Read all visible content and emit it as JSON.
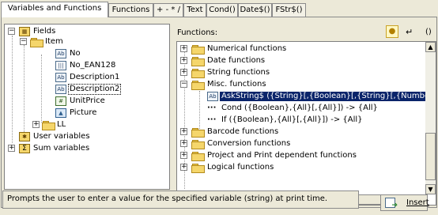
{
  "tabs": [
    {
      "label": "Variables and Functions"
    },
    {
      "label": "Functions"
    },
    {
      "label": "+ - * /"
    },
    {
      "label": "Text"
    },
    {
      "label": "Cond()"
    },
    {
      "label": "Date$()"
    },
    {
      "label": "FStr$()"
    }
  ],
  "left_tree": {
    "fields": "Fields",
    "item": "Item",
    "no": "No",
    "no_ean128": "No_EAN128",
    "description1": "Description1",
    "description2": "Description2",
    "unitprice": "UnitPrice",
    "picture": "Picture",
    "ll": "LL",
    "user_variables": "User variables",
    "sum_variables": "Sum variables"
  },
  "functions_label": "Functions:",
  "toolbar": {
    "enter_symbol": "↵",
    "paren_symbol": "()"
  },
  "right_tree": {
    "numerical": "Numerical functions",
    "date": "Date functions",
    "string": "String functions",
    "misc": "Misc. functions",
    "askstring": "AskString$ ({String}[,{Boolean}[,{String}[,{Number}]]]) -> {String}",
    "cond": "Cond ({Boolean},{All}[,{All}]) -> {All}",
    "if": "If ({Boolean},{All}[,{All}]) -> {All}",
    "barcode": "Barcode functions",
    "conversion": "Conversion functions",
    "project_print": "Project and Print dependent functions",
    "logical": "Logical functions"
  },
  "status_text": "Prompts the user to enter a value for the specified variable (string) at print time.",
  "insert_label": "Insert",
  "icons": {
    "fields": "table-icon",
    "field": "text-field-icon",
    "barcode": "barcode-icon",
    "user_vars": "user-variable-icon",
    "sum_vars": "sum-icon",
    "bulb": "lightbulb-icon"
  },
  "colors": {
    "selection": "#0a246a",
    "folder": "#f5d66b"
  }
}
